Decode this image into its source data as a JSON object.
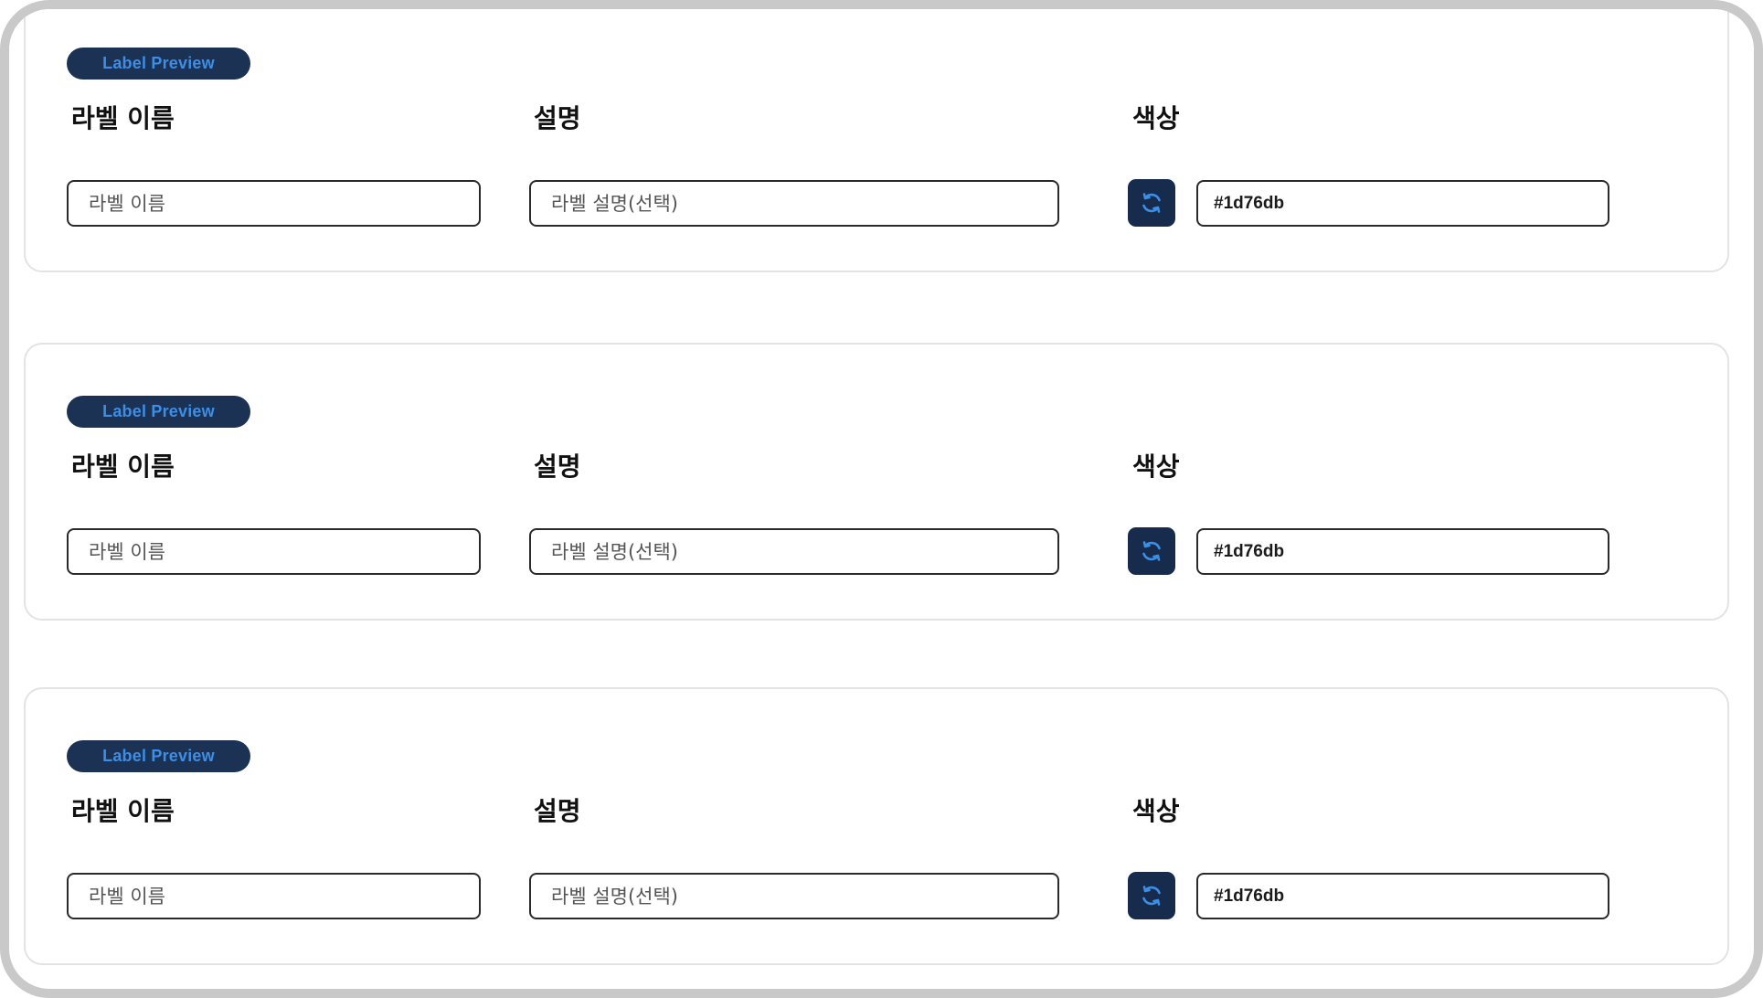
{
  "colors": {
    "badge_bg": "#1b3255",
    "badge_text": "#3c8ee6",
    "button_bg": "#172b4d",
    "button_icon": "#3c8ee6"
  },
  "cards": [
    {
      "badge": "Label Preview",
      "name_label": "라벨 이름",
      "name_placeholder": "라벨 이름",
      "description_label": "설명",
      "description_placeholder": "라벨 설명(선택)",
      "color_label": "색상",
      "refresh_icon": "refresh-icon",
      "color_value": "#1d76db"
    },
    {
      "badge": "Label Preview",
      "name_label": "라벨 이름",
      "name_placeholder": "라벨 이름",
      "description_label": "설명",
      "description_placeholder": "라벨 설명(선택)",
      "color_label": "색상",
      "refresh_icon": "refresh-icon",
      "color_value": "#1d76db"
    },
    {
      "badge": "Label Preview",
      "name_label": "라벨 이름",
      "name_placeholder": "라벨 이름",
      "description_label": "설명",
      "description_placeholder": "라벨 설명(선택)",
      "color_label": "색상",
      "refresh_icon": "refresh-icon",
      "color_value": "#1d76db"
    }
  ]
}
